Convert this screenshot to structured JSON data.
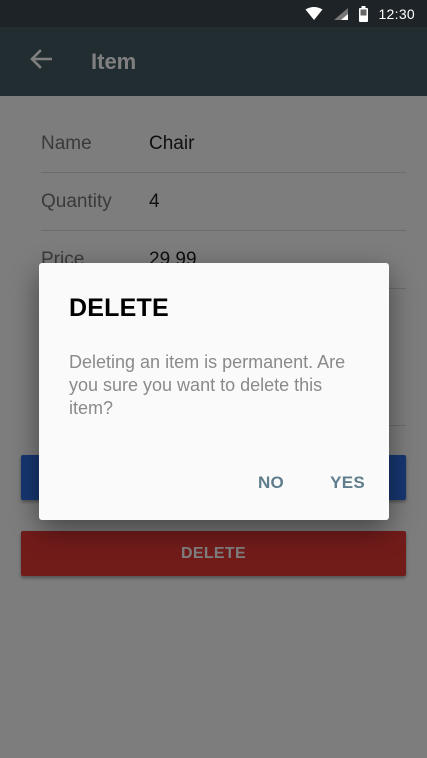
{
  "status_bar": {
    "time": "12:30",
    "icons": [
      "wifi-icon",
      "signal-icon",
      "battery-icon"
    ]
  },
  "toolbar": {
    "title": "Item",
    "back_icon": "arrow-left-icon"
  },
  "form": {
    "rows": [
      {
        "label": "Name",
        "value": "Chair"
      },
      {
        "label": "Quantity",
        "value": "4"
      },
      {
        "label": "Price",
        "value": "29.99"
      }
    ],
    "delete_label": "DELETE"
  },
  "dialog": {
    "title": "DELETE",
    "message": "Deleting an item is permanent. Are you sure you want to delete this item?",
    "no_label": "NO",
    "yes_label": "YES"
  },
  "colors": {
    "toolbar": "#455a64",
    "status_bar": "#1d2326",
    "save_button": "#2f6fe4",
    "delete_button": "#e53935",
    "dialog_action": "#5f7d8c"
  }
}
